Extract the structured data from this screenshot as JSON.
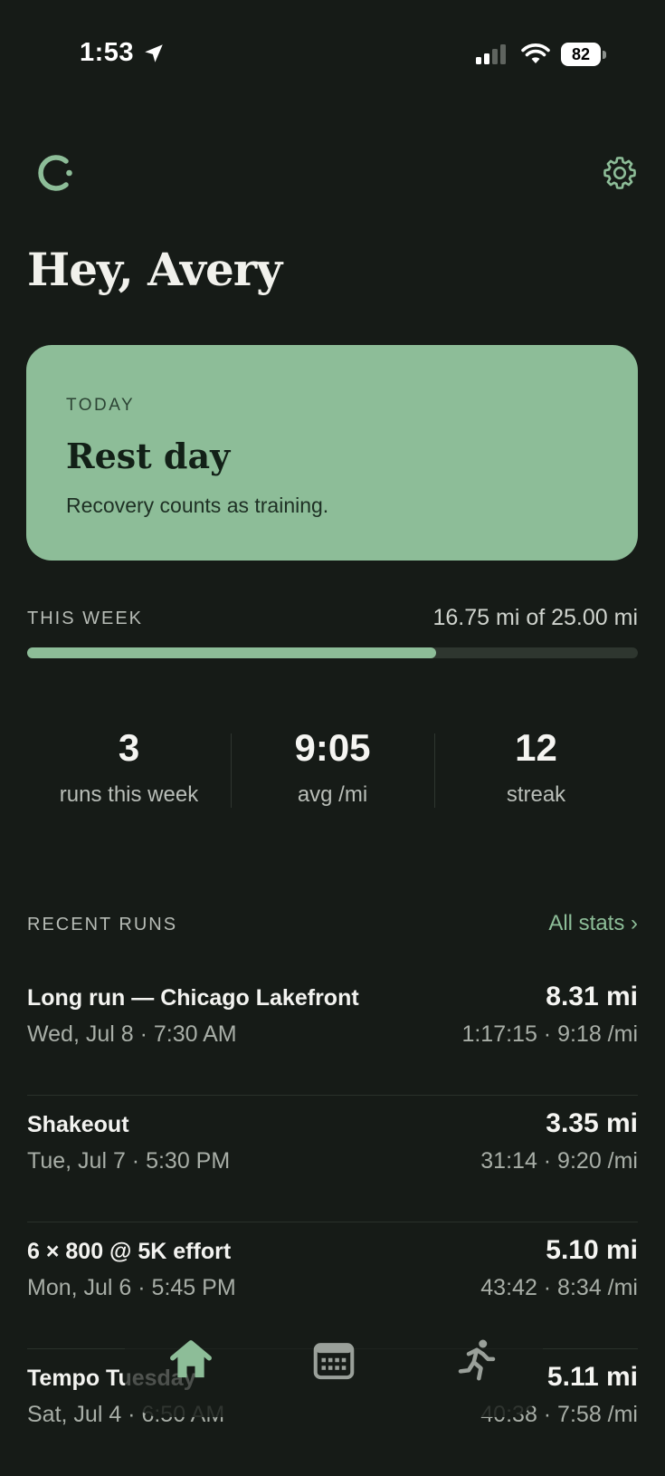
{
  "status_bar": {
    "time": "1:53",
    "battery": "82"
  },
  "header": {
    "greeting": "Hey, Avery"
  },
  "today": {
    "label": "TODAY",
    "title": "Rest day",
    "subtitle": "Recovery counts as training."
  },
  "week": {
    "label": "THIS WEEK",
    "progress_text": "16.75 mi of 25.00 mi",
    "progress_fraction": 0.67
  },
  "stats": [
    {
      "value": "3",
      "label": "runs this week"
    },
    {
      "value": "9:05",
      "label": "avg /mi"
    },
    {
      "value": "12",
      "label": "streak"
    }
  ],
  "recent": {
    "label": "RECENT RUNS",
    "all_stats": "All stats ›",
    "runs": [
      {
        "title": "Long run — Chicago Lakefront",
        "date": "Wed, Jul 8 · 7:30 AM",
        "distance": "8.31 mi",
        "meta": "1:17:15 · 9:18 /mi"
      },
      {
        "title": "Shakeout",
        "date": "Tue, Jul 7 · 5:30 PM",
        "distance": "3.35 mi",
        "meta": "31:14 · 9:20 /mi"
      },
      {
        "title": "6 × 800 @ 5K effort",
        "date": "Mon, Jul 6 · 5:45 PM",
        "distance": "5.10 mi",
        "meta": "43:42 · 8:34 /mi"
      },
      {
        "title": "Tempo Tuesday",
        "date": "Sat, Jul 4 · 6:50 AM",
        "distance": "5.11 mi",
        "meta": "40:38 · 7:58 /mi"
      }
    ]
  },
  "tabs": [
    {
      "name": "home-icon",
      "active": true
    },
    {
      "name": "calendar-icon",
      "active": false
    },
    {
      "name": "runner-icon",
      "active": false
    }
  ],
  "colors": {
    "background": "#161b17",
    "accent": "#8dbd98",
    "card_text": "#122017"
  }
}
